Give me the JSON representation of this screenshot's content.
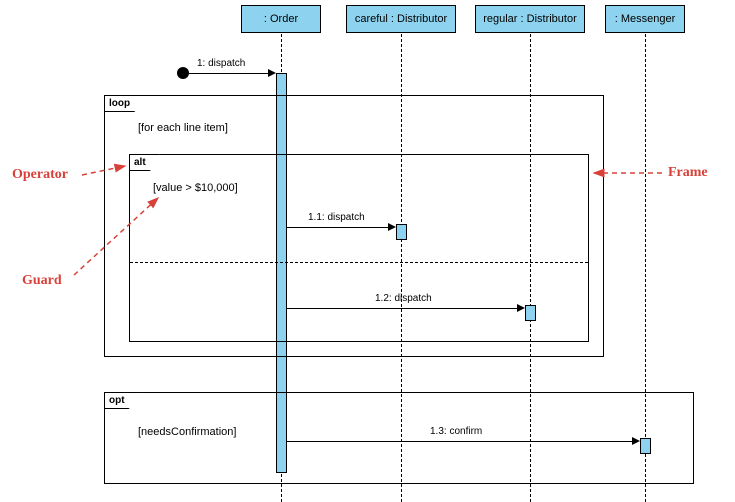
{
  "participants": {
    "order": {
      "label": ": Order"
    },
    "careful": {
      "label": "careful : Distributor"
    },
    "regular": {
      "label": "regular : Distributor"
    },
    "messenger": {
      "label": ": Messenger"
    }
  },
  "frames": {
    "loop": {
      "operator": "loop",
      "guard": "[for each line item]"
    },
    "alt": {
      "operator": "alt",
      "guard": "[value > $10,000]"
    },
    "opt": {
      "operator": "opt",
      "guard": "[needsConfirmation]"
    }
  },
  "messages": {
    "m0": {
      "label": "1: dispatch"
    },
    "m1": {
      "label": "1.1: dispatch"
    },
    "m2": {
      "label": "1.2: dispatch"
    },
    "m3": {
      "label": "1.3: confirm"
    }
  },
  "annotations": {
    "operator": "Operator",
    "guard": "Guard",
    "frame": "Frame"
  },
  "colors": {
    "fill": "#8dd3f0",
    "annotation": "#d8413a"
  }
}
